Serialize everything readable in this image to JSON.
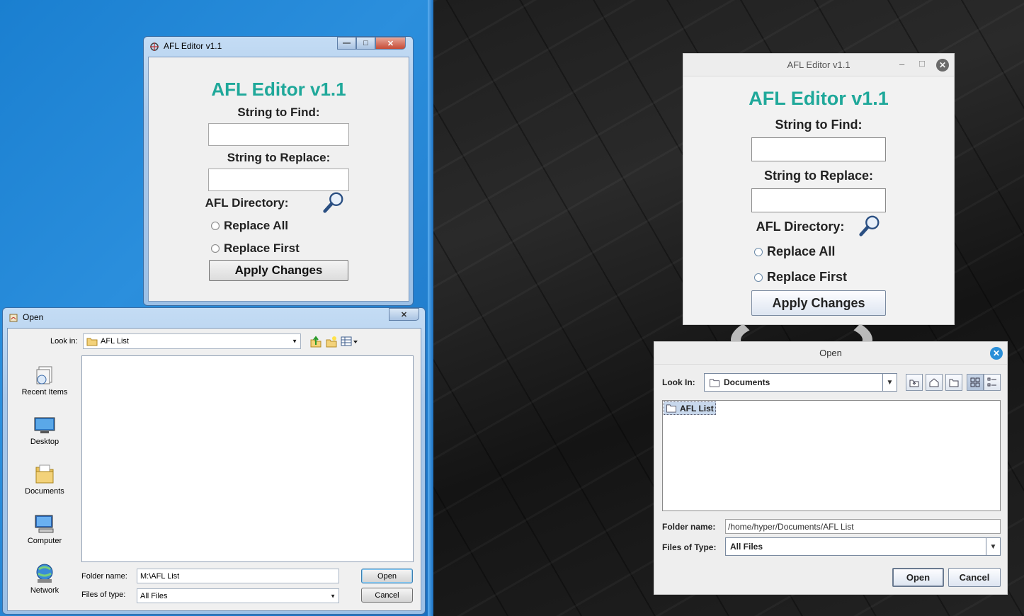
{
  "left_editor": {
    "window_title": "AFL Editor v1.1",
    "heading": "AFL Editor v1.1",
    "find_label": "String to Find:",
    "find_value": "",
    "replace_label": "String to Replace:",
    "replace_value": "",
    "directory_label": "AFL Directory:",
    "radio_all": "Replace All",
    "radio_first": "Replace First",
    "apply_button": "Apply Changes",
    "minimize": "—",
    "maximize": "□",
    "close": "✕"
  },
  "left_open_dialog": {
    "title": "Open",
    "close": "✕",
    "look_in_label": "Look in:",
    "look_in_value": "AFL List",
    "places": [
      {
        "label": "Recent Items",
        "icon": "recent-items-icon"
      },
      {
        "label": "Desktop",
        "icon": "desktop-icon"
      },
      {
        "label": "Documents",
        "icon": "documents-icon"
      },
      {
        "label": "Computer",
        "icon": "computer-icon"
      },
      {
        "label": "Network",
        "icon": "network-icon"
      }
    ],
    "folder_name_label": "Folder name:",
    "folder_name_value": "M:\\AFL List",
    "files_type_label": "Files of type:",
    "files_type_value": "All Files",
    "open_button": "Open",
    "cancel_button": "Cancel"
  },
  "right_editor": {
    "window_title": "AFL Editor v1.1",
    "heading": "AFL Editor v1.1",
    "find_label": "String to Find:",
    "find_value": "",
    "replace_label": "String to Replace:",
    "replace_value": "",
    "directory_label": "AFL Directory:",
    "radio_all": "Replace All",
    "radio_first": "Replace First",
    "apply_button": "Apply Changes",
    "minimize": "–",
    "maximize": "□",
    "close": "✕"
  },
  "right_open_dialog": {
    "title": "Open",
    "close": "✕",
    "look_in_label": "Look In:",
    "look_in_value": "Documents",
    "files": [
      "AFL List"
    ],
    "folder_name_label": "Folder name:",
    "folder_name_value": "/home/hyper/Documents/AFL List",
    "files_type_label": "Files of Type:",
    "files_type_value": "All Files",
    "open_button": "Open",
    "cancel_button": "Cancel"
  },
  "colors": {
    "heading_teal": "#1fa89a",
    "win7_desktop": "#1a7fd0",
    "gtk_close": "#2a8fd8"
  }
}
